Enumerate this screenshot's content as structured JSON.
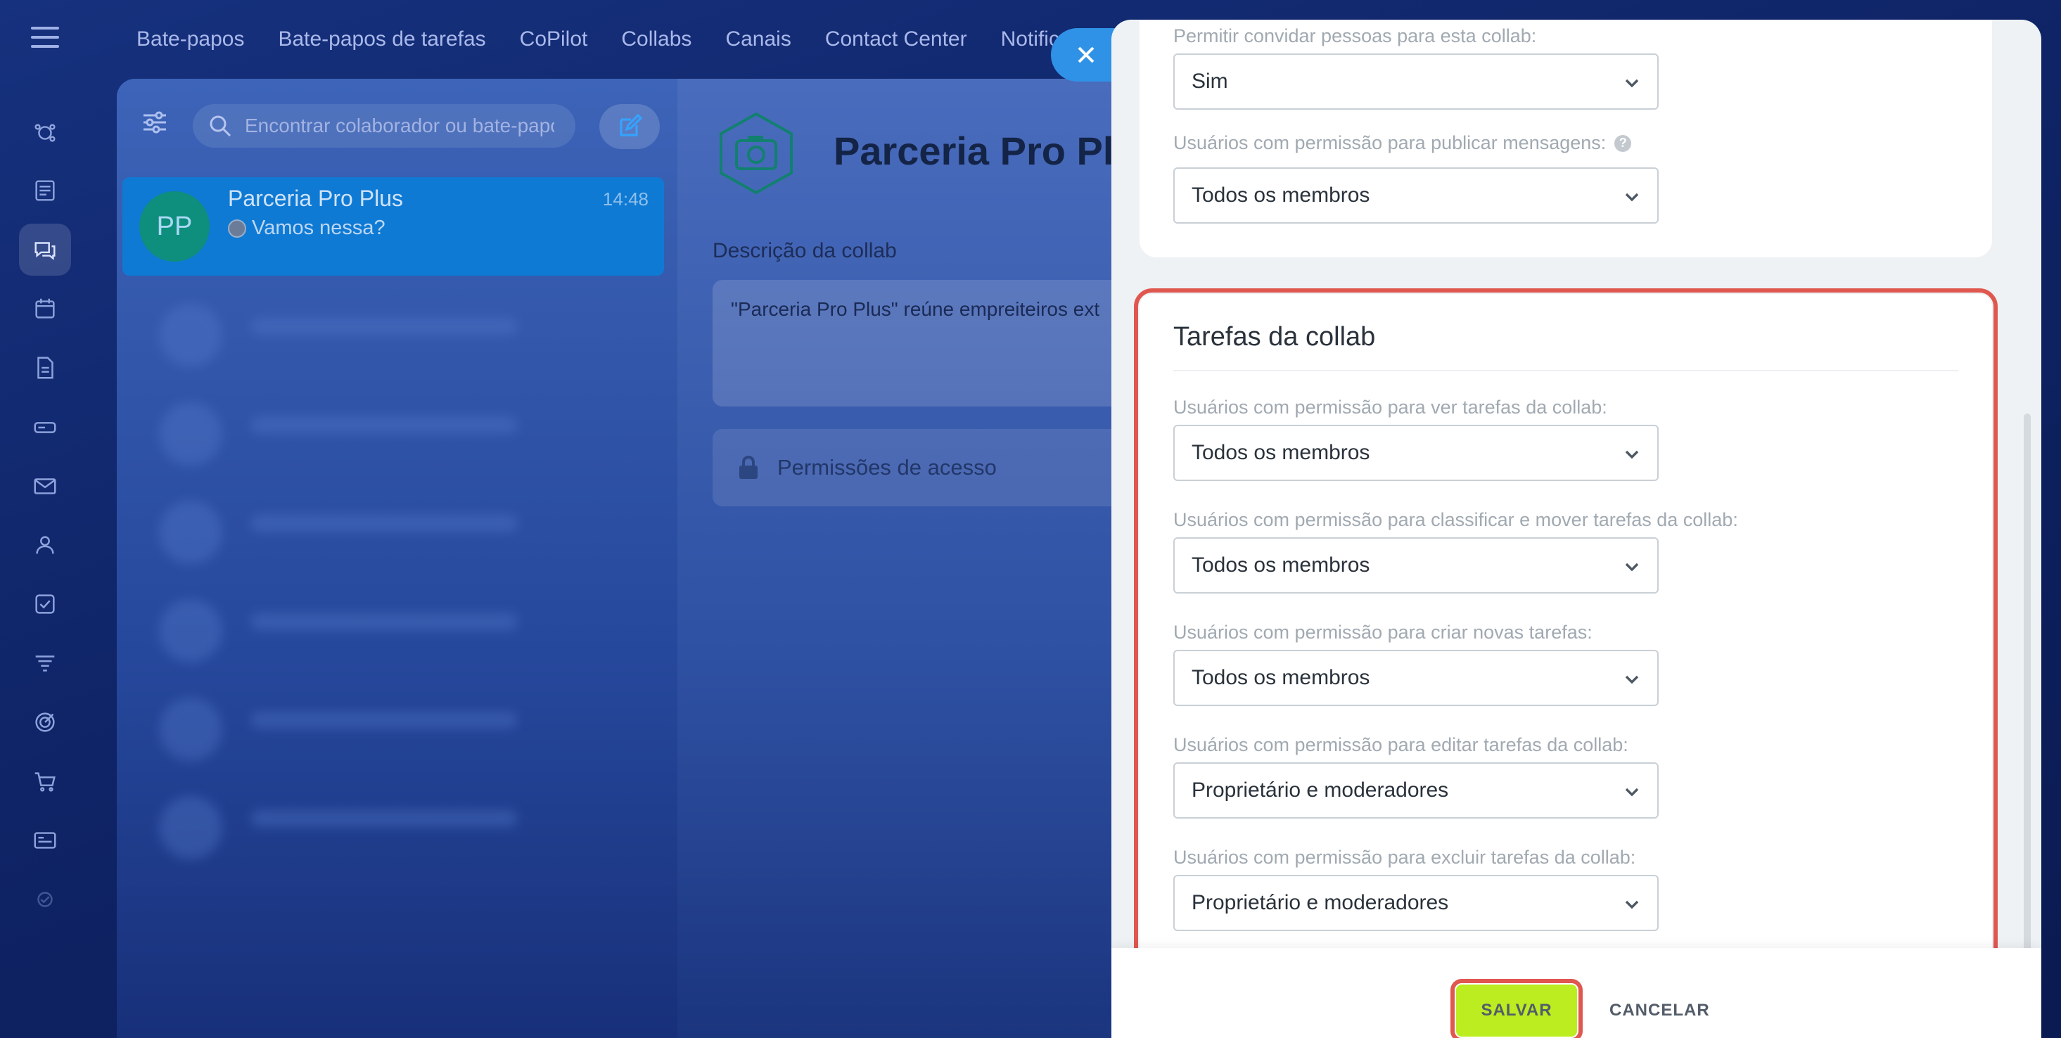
{
  "top_nav": [
    "Bate-papos",
    "Bate-papos de tarefas",
    "CoPilot",
    "Collabs",
    "Canais",
    "Contact Center",
    "Notificaç"
  ],
  "rail_icons": [
    "feed-icon",
    "news-icon",
    "chat-icon",
    "calendar-icon",
    "document-icon",
    "drive-icon",
    "mail-icon",
    "people-icon",
    "tasks-icon",
    "filter-icon",
    "target-icon",
    "cart-icon",
    "card-icon",
    "settings-icon"
  ],
  "chat_list": {
    "search_placeholder": "Encontrar colaborador ou bate-papo",
    "active_chat": {
      "avatar_initials": "PP",
      "name": "Parceria Pro Plus",
      "time": "14:48",
      "last_message": "Vamos nessa?"
    }
  },
  "chat_detail": {
    "title": "Parceria Pro Plus",
    "description_label": "Descrição da collab",
    "description_text": "\"Parceria Pro Plus\" reúne empreiteiros ext",
    "permissions_label": "Permissões de acesso"
  },
  "settings": {
    "invite": {
      "label": "Permitir convidar pessoas para esta collab:",
      "value": "Sim"
    },
    "publish": {
      "label": "Usuários com permissão para publicar mensagens:",
      "help": "?",
      "value": "Todos os membros"
    },
    "tasks_section": {
      "title": "Tarefas da collab",
      "fields": [
        {
          "label": "Usuários com permissão para ver tarefas da collab:",
          "value": "Todos os membros"
        },
        {
          "label": "Usuários com permissão para classificar e mover tarefas da collab:",
          "value": "Todos os membros"
        },
        {
          "label": "Usuários com permissão para criar novas tarefas:",
          "value": "Todos os membros"
        },
        {
          "label": "Usuários com permissão para editar tarefas da collab:",
          "value": "Proprietário e moderadores"
        },
        {
          "label": "Usuários com permissão para excluir tarefas da collab:",
          "value": "Proprietário e moderadores"
        }
      ]
    }
  },
  "footer": {
    "save_label": "SALVAR",
    "cancel_label": "CANCELAR"
  },
  "colors": {
    "accent_highlight": "#e0574f",
    "save_button": "#bbed21",
    "background_blue": "#16317e",
    "active_chat": "#0f7ad4"
  }
}
